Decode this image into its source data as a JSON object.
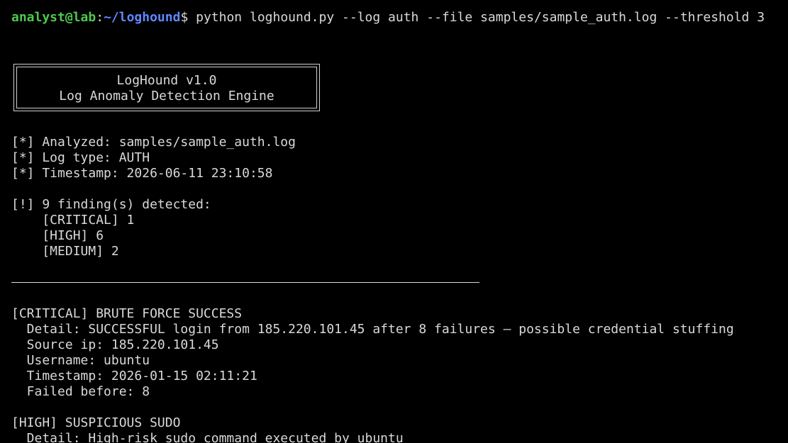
{
  "prompt": {
    "user_host": "analyst@lab",
    "colon": ":",
    "path": "~/loghound",
    "symbol": "$",
    "command": " python loghound.py --log auth --file samples/sample_auth.log --threshold 3"
  },
  "banner": {
    "title": "LogHound v1.0",
    "subtitle": "Log Anomaly Detection Engine"
  },
  "info": [
    "[*] Analyzed: samples/sample_auth.log",
    "[*] Log type: AUTH",
    "[*] Timestamp: 2026-06-11 23:10:58"
  ],
  "summary": {
    "header": "[!] 9 finding(s) detected:",
    "counts": [
      "    [CRITICAL] 1",
      "    [HIGH] 6",
      "    [MEDIUM] 2"
    ]
  },
  "findings": [
    {
      "title": "[CRITICAL] BRUTE FORCE SUCCESS",
      "lines": [
        "  Detail: SUCCESSFUL login from 185.220.101.45 after 8 failures — possible credential stuffing",
        "  Source ip: 185.220.101.45",
        "  Username: ubuntu",
        "  Timestamp: 2026-01-15 02:11:21",
        "  Failed before: 8"
      ]
    },
    {
      "title": "[HIGH] SUSPICIOUS SUDO",
      "lines": [
        "  Detail: High-risk sudo command executed by ubuntu"
      ]
    }
  ]
}
